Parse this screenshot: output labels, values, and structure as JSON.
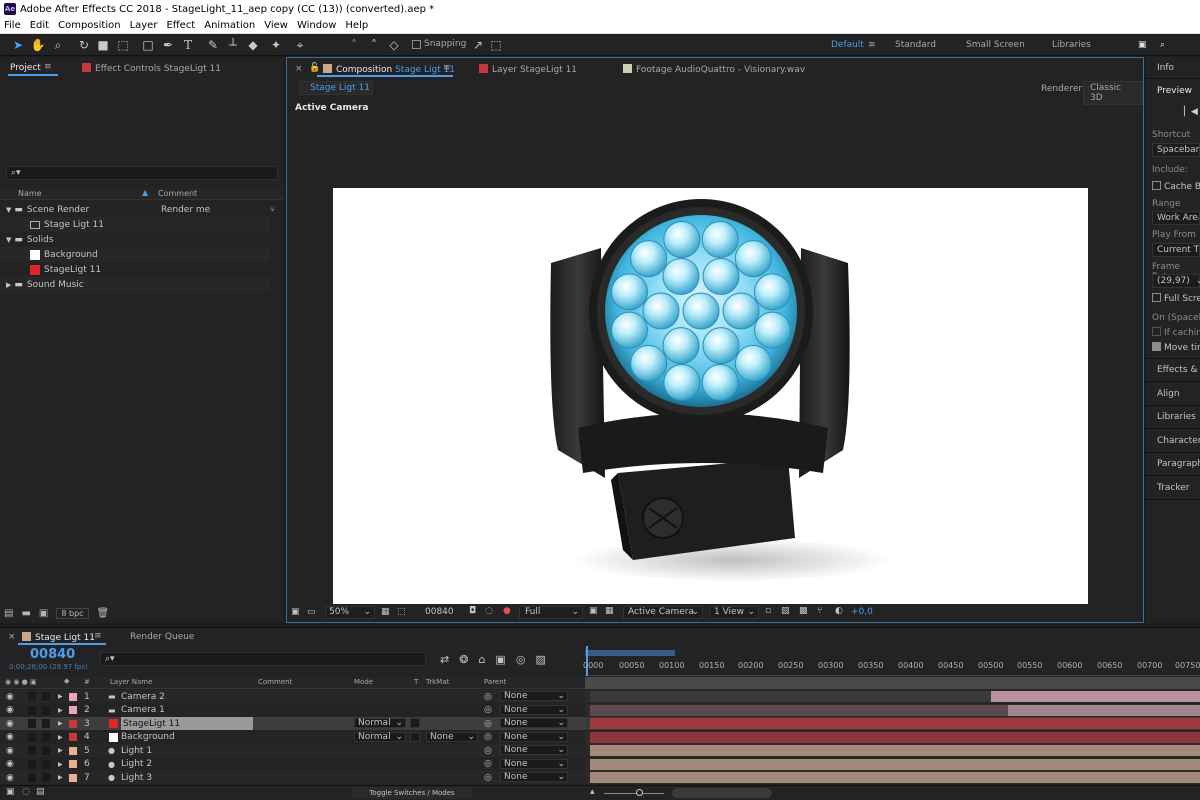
{
  "window": {
    "title": "Adobe After Effects CC 2018 - StageLight_11_aep copy (CC (13)) (converted).aep *",
    "app_badge": "Ae"
  },
  "menu": [
    "File",
    "Edit",
    "Composition",
    "Layer",
    "Effect",
    "Animation",
    "View",
    "Window",
    "Help"
  ],
  "toolbar": {
    "snapping": "Snapping",
    "workspaces": [
      "Default",
      "Standard",
      "Small Screen",
      "Libraries"
    ],
    "search_glyph": "⌕"
  },
  "project_panel": {
    "tab_project": "Project",
    "tab_effects": "Effect Controls StageLigt 11",
    "search_glyph": "⌕▾",
    "col_name": "Name",
    "col_comment": "Comment",
    "items": [
      {
        "name": "Scene Render",
        "comment": "Render me",
        "kind": "folder"
      },
      {
        "name": "Stage Ligt 11",
        "comment": "",
        "kind": "comp"
      },
      {
        "name": "Solids",
        "comment": "",
        "kind": "folder"
      },
      {
        "name": "Background",
        "comment": "",
        "kind": "solid",
        "color": "#ffffff"
      },
      {
        "name": "StageLigt 11",
        "comment": "",
        "kind": "solid",
        "color": "#e0262b"
      },
      {
        "name": "Sound Music",
        "comment": "",
        "kind": "folder"
      }
    ],
    "bpc": "8 bpc"
  },
  "viewer": {
    "tab_comp_prefix": "Composition",
    "tab_comp_name": "Stage Ligt 11",
    "tab_layer": "Layer  StageLigt 11",
    "tab_footage": "Footage  AudioQuattro - Visionary.wav",
    "breadcrumb": "Stage Ligt 11",
    "renderer_label": "Renderer:",
    "renderer_value": "Classic 3D",
    "view_label": "Active Camera",
    "zoom": "50%",
    "timecode": "00840",
    "resolution": "Full",
    "camera": "Active Camera",
    "views": "1 View",
    "exposure": "+0,0"
  },
  "right_panel": {
    "info": "Info",
    "preview": "Preview",
    "skip_glyph": "▏◀",
    "shortcut_label": "Shortcut",
    "shortcut_value": "Spacebar",
    "include_label": "Include:",
    "cache_label": "Cache Be",
    "range_label": "Range",
    "range_value": "Work Area",
    "play_from_label": "Play From",
    "play_from_value": "Current Tir",
    "frame_rate_label": "Frame Rate",
    "frame_rate_value": "(29,97)",
    "full_screen_label": "Full Scre",
    "on_spacebar_label": "On (Spaceba",
    "if_caching_label": "If caching",
    "move_time_label": "Move tin",
    "panels": [
      "Effects & P",
      "Align",
      "Libraries",
      "Character",
      "Paragraph",
      "Tracker"
    ]
  },
  "timeline": {
    "tab_comp": "Stage Ligt 11",
    "tab_render_queue": "Render Queue",
    "timecode": "00840",
    "timecode_sub": "0;00;28;00 (29.97 fps)",
    "search_glyph": "⌕▾",
    "col_num": "#",
    "col_layer_name": "Layer Name",
    "col_comment": "Comment",
    "col_mode": "Mode",
    "col_t": "T",
    "col_trkmat": "TrkMat",
    "col_parent": "Parent",
    "toggle_label": "Toggle Switches / Modes",
    "ruler": [
      "0000",
      "00050",
      "00100",
      "00150",
      "00200",
      "00250",
      "00300",
      "00350",
      "00400",
      "00450",
      "00500",
      "00550",
      "00600",
      "00650",
      "00700",
      "00750"
    ],
    "layers": [
      {
        "num": "1",
        "name": "Camera 2",
        "kind": "camera",
        "label_color": "#e8a5b4",
        "mode": "",
        "trkmat": "",
        "parent": "None",
        "selected": false
      },
      {
        "num": "2",
        "name": "Camera 1",
        "kind": "camera",
        "label_color": "#e8a5b4",
        "mode": "",
        "trkmat": "",
        "parent": "None",
        "selected": false
      },
      {
        "num": "3",
        "name": "StageLigt 11",
        "kind": "solid",
        "label_color": "#c7383c",
        "chip": "#e0262b",
        "mode": "Normal",
        "trkmat": "",
        "parent": "None",
        "selected": true
      },
      {
        "num": "4",
        "name": "Background",
        "kind": "solid",
        "label_color": "#c7383c",
        "chip": "#ffffff",
        "mode": "Normal",
        "trkmat": "None",
        "parent": "None",
        "selected": false
      },
      {
        "num": "5",
        "name": "Light 1",
        "kind": "light",
        "label_color": "#e8b08e",
        "mode": "",
        "trkmat": "",
        "parent": "None",
        "selected": false
      },
      {
        "num": "6",
        "name": "Light 2",
        "kind": "light",
        "label_color": "#e8b08e",
        "mode": "",
        "trkmat": "",
        "parent": "None",
        "selected": false
      },
      {
        "num": "7",
        "name": "Light 3",
        "kind": "light",
        "label_color": "#e8b08e",
        "mode": "",
        "trkmat": "",
        "parent": "None",
        "selected": false
      }
    ]
  }
}
